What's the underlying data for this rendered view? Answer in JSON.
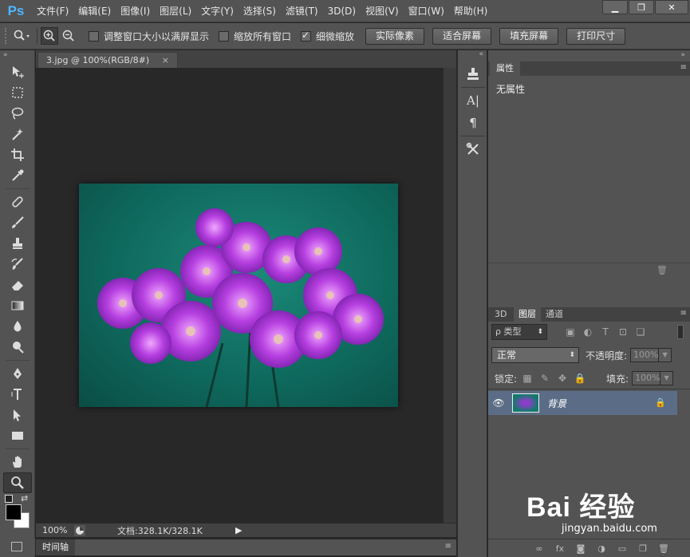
{
  "app": {
    "logo": "Ps"
  },
  "menu": [
    "文件(F)",
    "编辑(E)",
    "图像(I)",
    "图层(L)",
    "文字(Y)",
    "选择(S)",
    "滤镜(T)",
    "3D(D)",
    "视图(V)",
    "窗口(W)",
    "帮助(H)"
  ],
  "window_controls": {
    "minimize": "▁",
    "restore": "❐",
    "close": "✕"
  },
  "options": {
    "resize_windows": {
      "label": "调整窗口大小以满屏显示",
      "checked": false
    },
    "zoom_all": {
      "label": "缩放所有窗口",
      "checked": false
    },
    "scrubby_zoom": {
      "label": "细微缩放",
      "checked": true
    },
    "buttons": [
      "实际像素",
      "适合屏幕",
      "填充屏幕",
      "打印尺寸"
    ]
  },
  "document": {
    "tab_title": "3.jpg @ 100%(RGB/8#)",
    "tab_close": "×"
  },
  "status": {
    "zoom": "100%",
    "doc_info": "文档:328.1K/328.1K",
    "arrow": "▶"
  },
  "timeline": {
    "label": "时间轴"
  },
  "properties": {
    "tab": "属性",
    "empty_text": "无属性"
  },
  "layers": {
    "tabs": [
      "3D",
      "图层",
      "通道"
    ],
    "filter_label": "ρ 类型",
    "blend_mode": "正常",
    "opacity_label": "不透明度:",
    "opacity_value": "100%",
    "lock_label": "锁定:",
    "fill_label": "填充:",
    "fill_value": "100%",
    "items": [
      {
        "name": "背景",
        "visible": true,
        "locked": true
      }
    ]
  },
  "watermark": {
    "logo": "Bai   经验",
    "url": "jingyan.baidu.com"
  },
  "colors": {
    "ui_panel": "#535353",
    "canvas_bg": "#282828",
    "selected_layer": "#5b6d86",
    "ps_logo": "#4fb5ff"
  }
}
